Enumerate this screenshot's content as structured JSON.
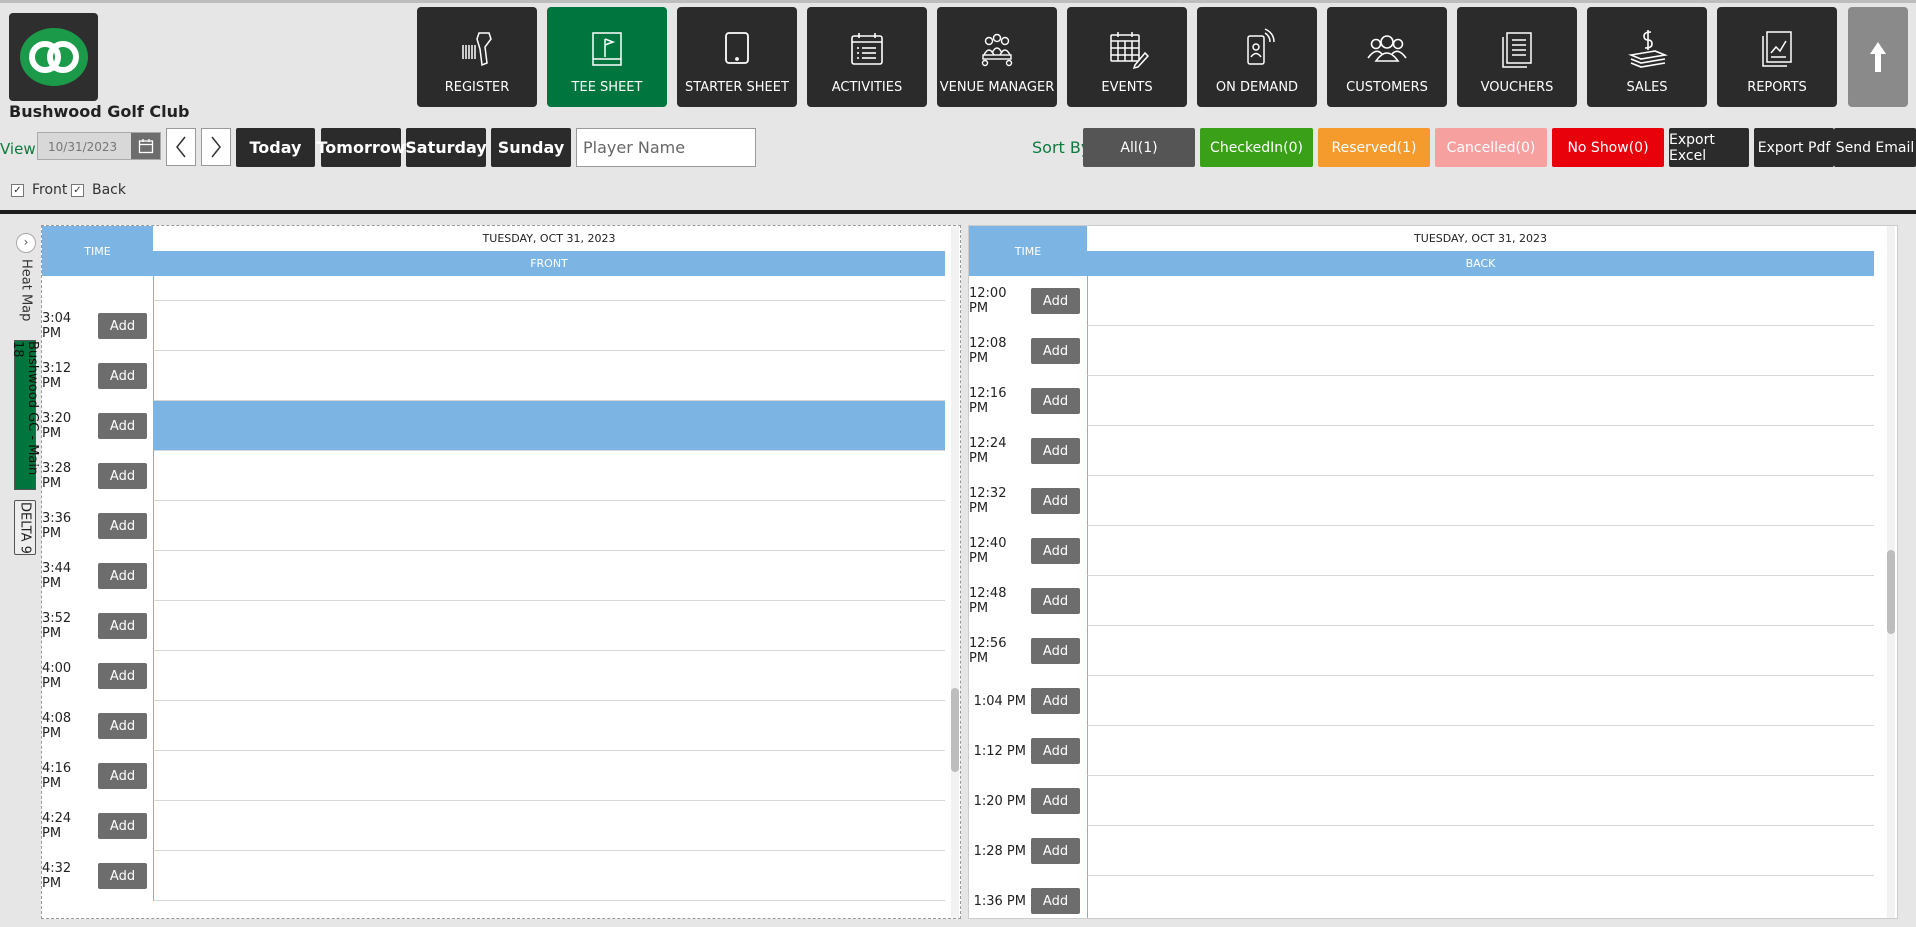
{
  "app": {
    "club_name": "Bushwood Golf Club"
  },
  "nav": [
    {
      "label": "REGISTER",
      "icon": "barcode-scanner-icon",
      "active": false
    },
    {
      "label": "TEE SHEET",
      "icon": "flag-board-icon",
      "active": true
    },
    {
      "label": "STARTER SHEET",
      "icon": "tablet-icon",
      "active": false
    },
    {
      "label": "ACTIVITIES",
      "icon": "calendar-list-icon",
      "active": false
    },
    {
      "label": "VENUE MANAGER",
      "icon": "group-table-icon",
      "active": false
    },
    {
      "label": "EVENTS",
      "icon": "calendar-edit-icon",
      "active": false
    },
    {
      "label": "ON DEMAND",
      "icon": "mobile-wireless-icon",
      "active": false
    },
    {
      "label": "CUSTOMERS",
      "icon": "users-icon",
      "active": false
    },
    {
      "label": "VOUCHERS",
      "icon": "documents-icon",
      "active": false
    },
    {
      "label": "SALES",
      "icon": "dollar-money-icon",
      "active": false
    },
    {
      "label": "REPORTS",
      "icon": "chart-report-icon",
      "active": false
    }
  ],
  "controls": {
    "view_label": "View",
    "date_value": "10/31/2023",
    "day_buttons": [
      "Today",
      "Tomorrow",
      "Saturday",
      "Sunday"
    ],
    "player_placeholder": "Player Name",
    "sort_by_label": "Sort By",
    "filters": [
      {
        "label": "All(1)",
        "color": "#555555"
      },
      {
        "label": "CheckedIn(0)",
        "color": "#3aa017"
      },
      {
        "label": "Reserved(1)",
        "color": "#f59b2e"
      },
      {
        "label": "Cancelled(0)",
        "color": "#f7a0a0"
      },
      {
        "label": "No Show(0)",
        "color": "#e8000b"
      }
    ],
    "exports": [
      "Export Excel",
      "Export Pdf",
      "Send Email"
    ],
    "checkboxes": [
      {
        "label": "Front",
        "checked": true
      },
      {
        "label": "Back",
        "checked": true
      }
    ]
  },
  "side_tabs": {
    "heat_map": "Heat Map",
    "course_main": "Bushwood GC - Main 18",
    "course_delta": "DELTA 9"
  },
  "front": {
    "time_header": "TIME",
    "date_header": "TUESDAY, OCT 31, 2023",
    "column_header": "FRONT",
    "add_label": "Add",
    "highlight_time": "3:20 PM",
    "slots": [
      "3:04 PM",
      "3:12 PM",
      "3:20 PM",
      "3:28 PM",
      "3:36 PM",
      "3:44 PM",
      "3:52 PM",
      "4:00 PM",
      "4:08 PM",
      "4:16 PM",
      "4:24 PM",
      "4:32 PM"
    ]
  },
  "back": {
    "time_header": "TIME",
    "date_header": "TUESDAY, OCT 31, 2023",
    "column_header": "BACK",
    "add_label": "Add",
    "slots": [
      "12:00 PM",
      "12:08 PM",
      "12:16 PM",
      "12:24 PM",
      "12:32 PM",
      "12:40 PM",
      "12:48 PM",
      "12:56 PM",
      "1:04 PM",
      "1:12 PM",
      "1:20 PM",
      "1:28 PM",
      "1:36 PM"
    ]
  }
}
